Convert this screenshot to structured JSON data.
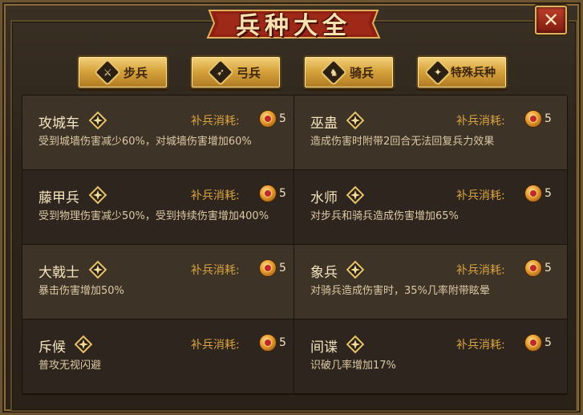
{
  "window": {
    "title": "兵种大全",
    "close_icon": "close-x-icon"
  },
  "tabs": [
    {
      "label": "步兵",
      "icon": "infantry-icon",
      "glyph": "⚔"
    },
    {
      "label": "弓兵",
      "icon": "archer-icon",
      "glyph": "➶"
    },
    {
      "label": "骑兵",
      "icon": "cavalry-icon",
      "glyph": "♞"
    },
    {
      "label": "特殊兵种",
      "icon": "special-troop-icon",
      "glyph": "✦"
    }
  ],
  "cost_label": "补兵消耗:",
  "units": [
    {
      "name": "攻城车",
      "cost": "5",
      "desc": "受到城墙伤害减少60%，对城墙伤害增加60%"
    },
    {
      "name": "巫蛊",
      "cost": "5",
      "desc": "造成伤害时附带2回合无法回复兵力效果"
    },
    {
      "name": "藤甲兵",
      "cost": "5",
      "desc": "受到物理伤害减少50%，受到持续伤害增加400%"
    },
    {
      "name": "水师",
      "cost": "5",
      "desc": "对步兵和骑兵造成伤害增加65%"
    },
    {
      "name": "大戟士",
      "cost": "5",
      "desc": "暴击伤害增加50%"
    },
    {
      "name": "象兵",
      "cost": "5",
      "desc": "对骑兵造成伤害时，35%几率附带眩晕"
    },
    {
      "name": "斥候",
      "cost": "5",
      "desc": "普攻无视闪避"
    },
    {
      "name": "间谍",
      "cost": "5",
      "desc": "识破几率增加17%"
    }
  ],
  "colors": {
    "gold": "#d9a441",
    "banner_red": "#8e1f12",
    "tab_gold": "#d7a43d"
  }
}
